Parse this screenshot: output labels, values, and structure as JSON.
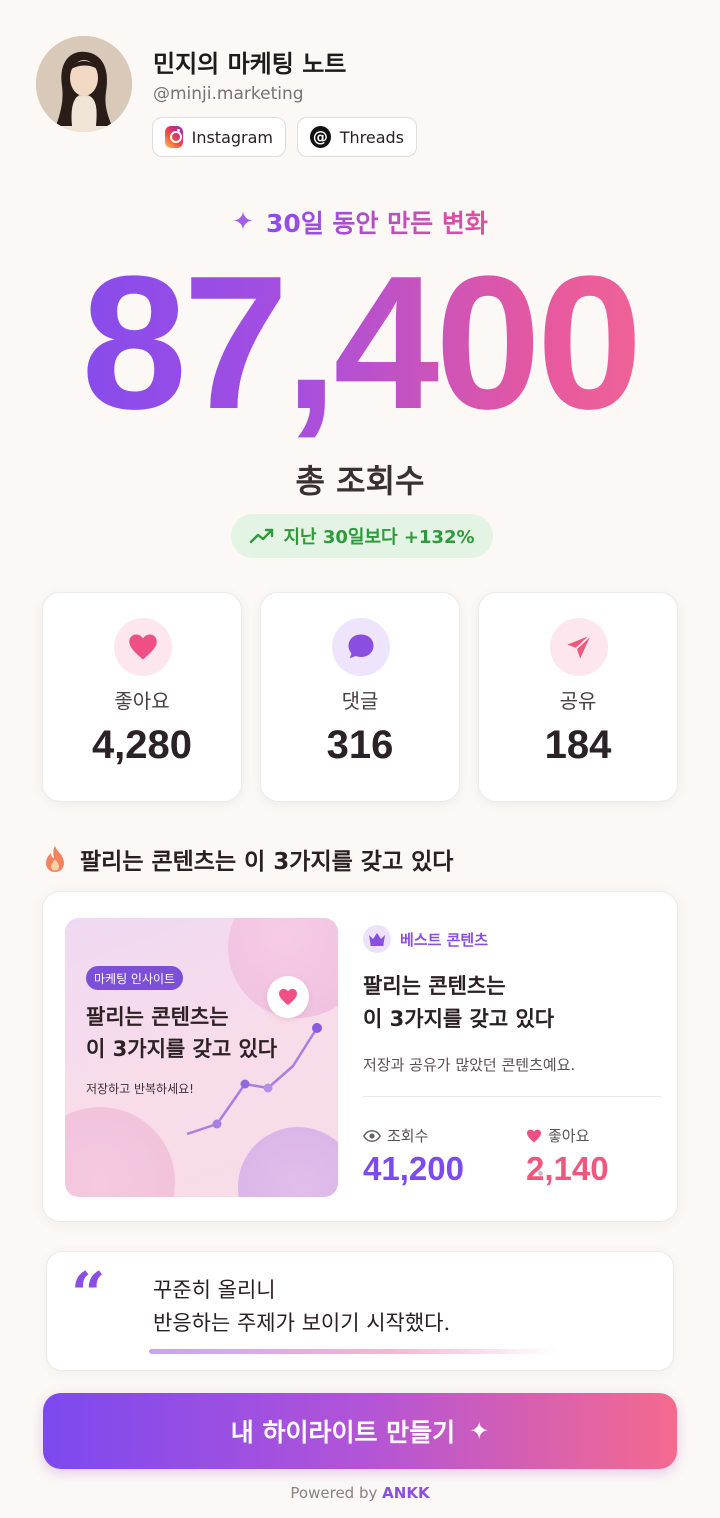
{
  "profile": {
    "name": "민지의 마케팅 노트",
    "handle": "@minji.marketing",
    "platforms": [
      "Instagram",
      "Threads"
    ]
  },
  "headline": {
    "period": "30일 동안 만든 변화",
    "total_views": "87,400",
    "total_label": "총 조회수",
    "growth": "지난 30일보다 +132%"
  },
  "stats": [
    {
      "label": "좋아요",
      "value": "4,280",
      "icon": "heart-icon",
      "color": "#f04f86",
      "bg": "#fde6ee"
    },
    {
      "label": "댓글",
      "value": "316",
      "icon": "chat-bubble-icon",
      "color": "#8a4fe0",
      "bg": "#eee4fb"
    },
    {
      "label": "공유",
      "value": "184",
      "icon": "paper-plane-icon",
      "color": "#f0577d",
      "bg": "#fde6ee"
    }
  ],
  "best_section": {
    "title": "팔리는 콘텐츠는\n이 3가지를 갖고 있다",
    "thumbnail": {
      "tag": "마케팅 인사이트",
      "title": "팔리는 콘텐츠는\n이 3가지를 갖고 있다",
      "subtitle": "저장하고 반복하세요!"
    },
    "badge": "베스트 콘텐츠",
    "description": "저장과 공유가 많았던 콘텐츠예요.",
    "views_label": "조회수",
    "views_value": "41,200",
    "likes_label": "좋아요",
    "likes_value": "2,140"
  },
  "quote": {
    "mark": "“",
    "text": "꾸준히 올리니\n반응하는 주제가 보이기 시작했다."
  },
  "cta": {
    "label": "내 하이라이트 만들기"
  },
  "footer": {
    "powered_prefix": "Powered by",
    "brand": "ANKK"
  },
  "colors": {
    "purple": "#7b4af1",
    "pink": "#f0577d",
    "green": "#2e9a3c",
    "background": "#fbf8f5"
  }
}
